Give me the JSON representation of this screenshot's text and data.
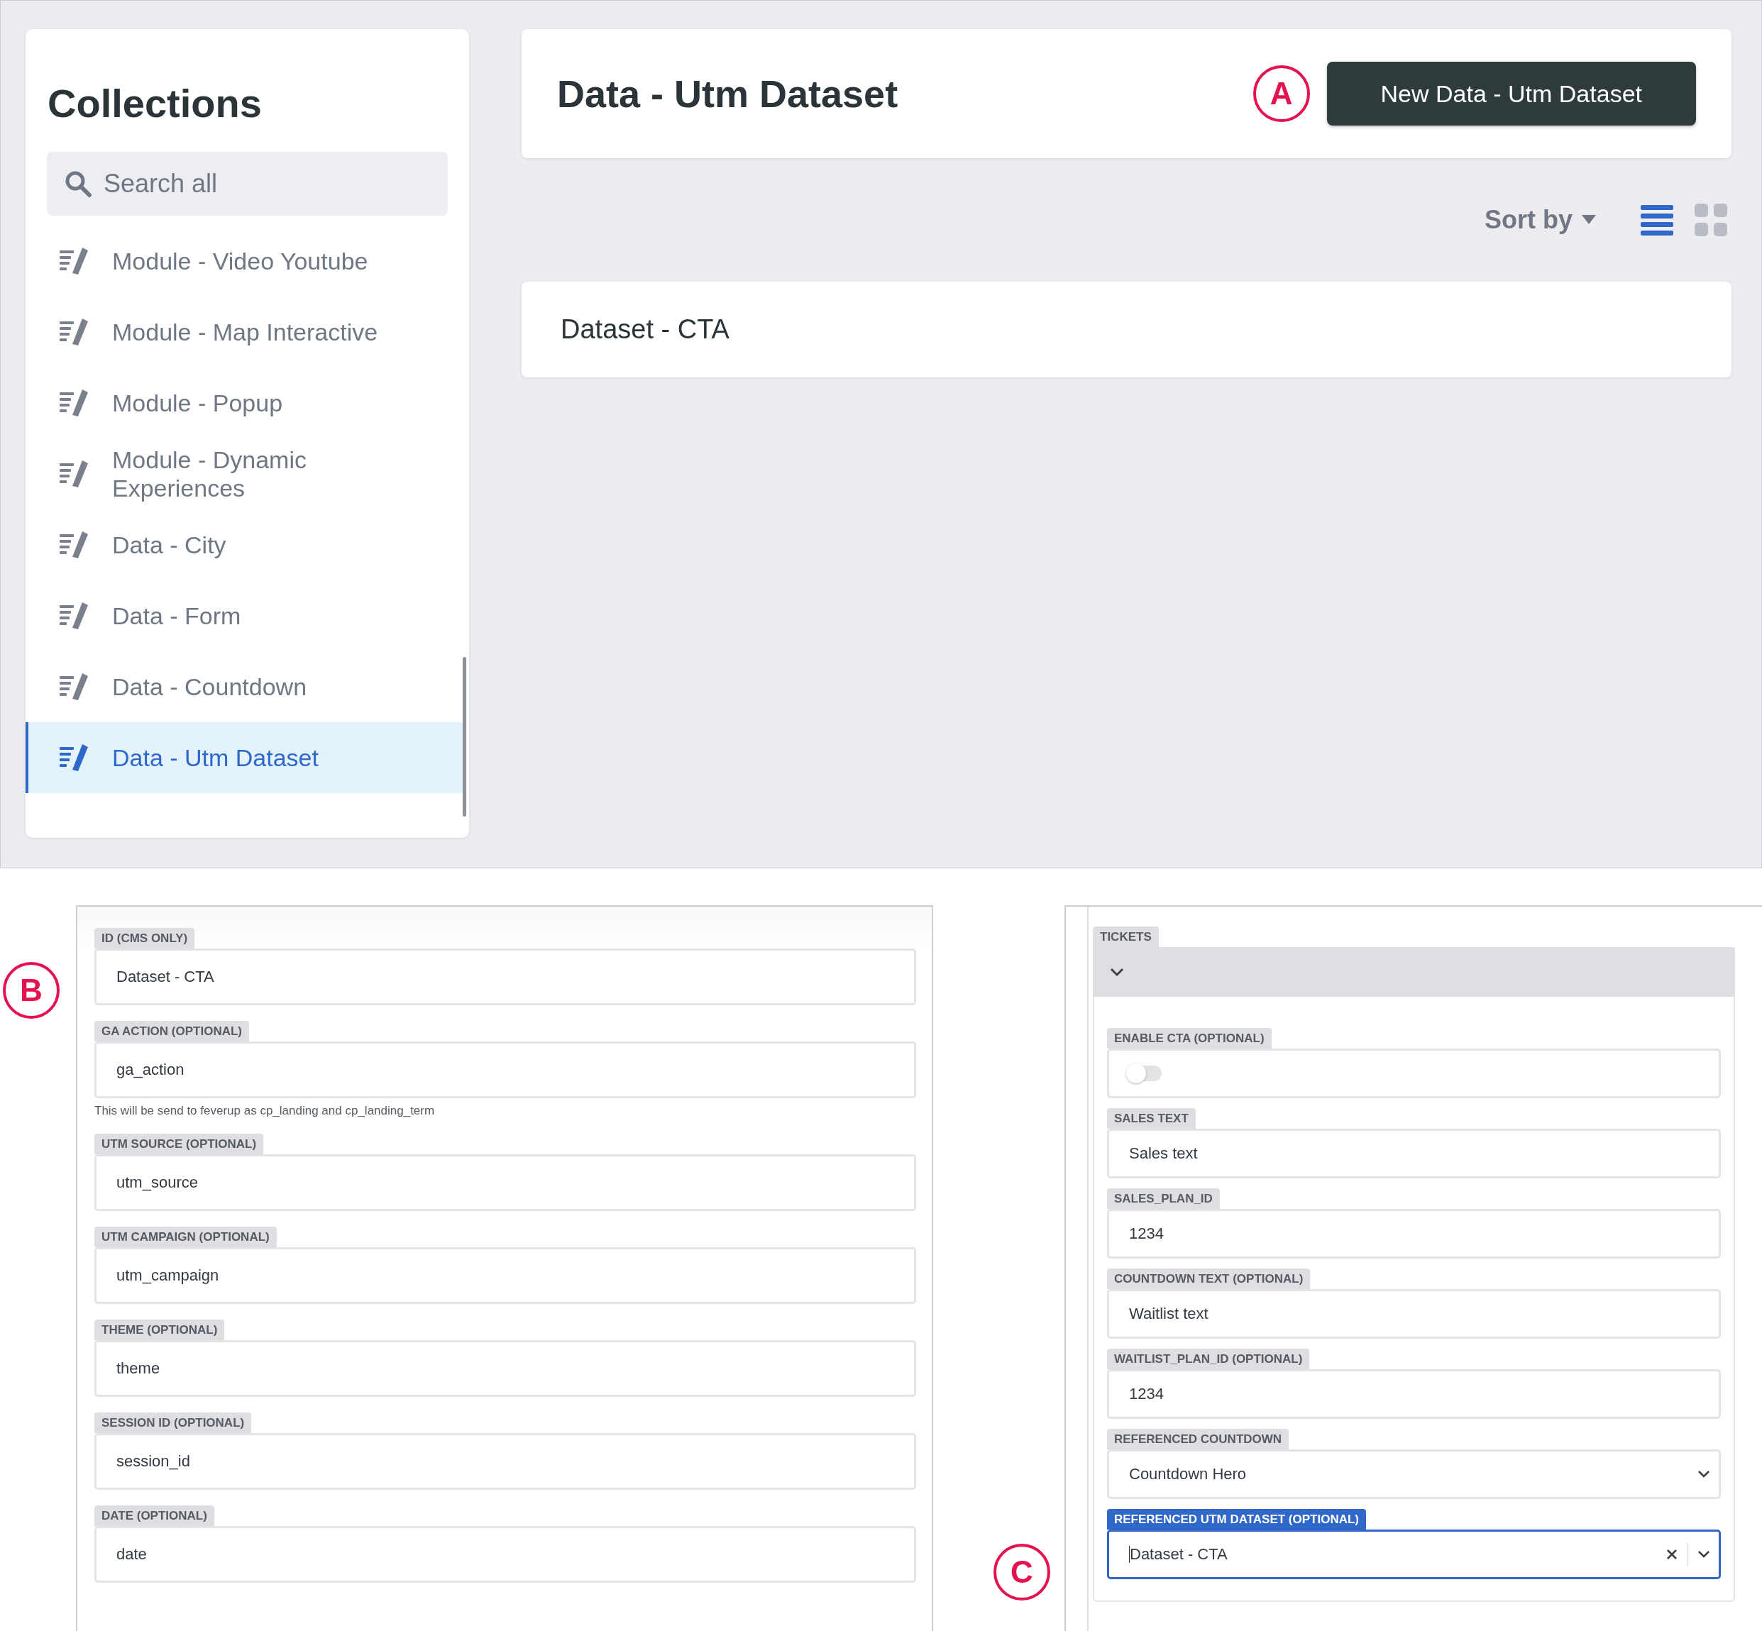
{
  "sidebar": {
    "title": "Collections",
    "search": {
      "placeholder": "Search all"
    },
    "items": [
      {
        "label": "Module - Video Youtube",
        "selected": false
      },
      {
        "label": "Module - Map Interactive",
        "selected": false
      },
      {
        "label": "Module - Popup",
        "selected": false
      },
      {
        "label": "Module - Dynamic Experiences",
        "selected": false
      },
      {
        "label": "Data - City",
        "selected": false
      },
      {
        "label": "Data - Form",
        "selected": false
      },
      {
        "label": "Data - Countdown",
        "selected": false
      },
      {
        "label": "Data - Utm Dataset",
        "selected": true
      }
    ]
  },
  "header": {
    "title": "Data - Utm Dataset",
    "button": "New Data - Utm Dataset",
    "marker": "A"
  },
  "toolbar": {
    "sort": "Sort by",
    "views": [
      {
        "kind": "list",
        "selected": true
      },
      {
        "kind": "grid",
        "selected": false
      }
    ]
  },
  "entries": [
    "Dataset - CTA"
  ],
  "form_b": {
    "marker": "B",
    "fields": [
      {
        "label": "ID (CMS ONLY)",
        "value": "Dataset - CTA"
      },
      {
        "label": "GA ACTION (OPTIONAL)",
        "value": "ga_action",
        "hint": "This will be send to feverup as cp_landing and cp_landing_term"
      },
      {
        "label": "UTM SOURCE (OPTIONAL)",
        "value": "utm_source"
      },
      {
        "label": "UTM CAMPAIGN (OPTIONAL)",
        "value": "utm_campaign"
      },
      {
        "label": "THEME (OPTIONAL)",
        "value": "theme"
      },
      {
        "label": "SESSION ID (OPTIONAL)",
        "value": "session_id"
      },
      {
        "label": "DATE (OPTIONAL)",
        "value": "date"
      }
    ]
  },
  "form_c": {
    "marker": "C",
    "section": "TICKETS",
    "expanded": true,
    "fields": [
      {
        "kind": "toggle",
        "label": "ENABLE CTA (OPTIONAL)",
        "on": false,
        "focused": false
      },
      {
        "kind": "text",
        "label": "SALES TEXT",
        "value": "Sales text",
        "focused": false
      },
      {
        "kind": "text",
        "label": "SALES_PLAN_ID",
        "value": "1234",
        "focused": false
      },
      {
        "kind": "text",
        "label": "COUNTDOWN TEXT (OPTIONAL)",
        "value": "Waitlist text",
        "focused": false
      },
      {
        "kind": "text",
        "label": "WAITLIST_PLAN_ID (OPTIONAL)",
        "value": "1234",
        "focused": false
      },
      {
        "kind": "select",
        "label": "REFERENCED COUNTDOWN",
        "value": "Countdown Hero",
        "clearable": false,
        "focused": false
      },
      {
        "kind": "select",
        "label": "REFERENCED UTM DATASET (OPTIONAL)",
        "value": "Dataset - CTA",
        "clearable": true,
        "focused": true
      }
    ]
  }
}
